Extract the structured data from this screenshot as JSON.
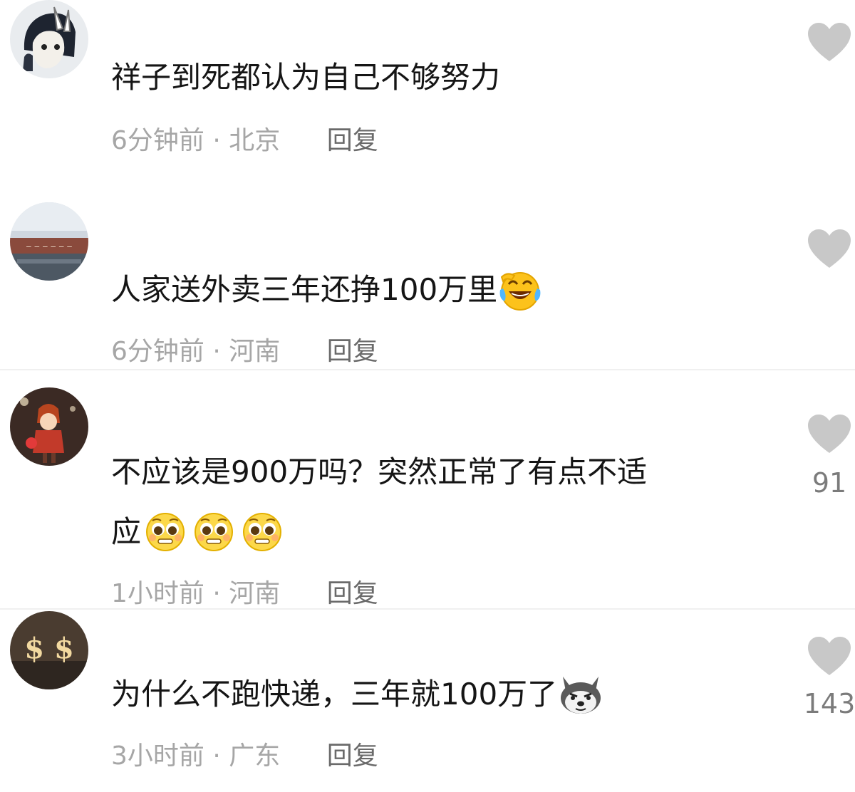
{
  "comments": [
    {
      "text": "祥子到死都认为自己不够努力",
      "time": "6分钟前",
      "location": "北京",
      "reply_label": "回复",
      "likes": ""
    },
    {
      "text": "人家送外卖三年还挣100万里",
      "time": "6分钟前",
      "location": "河南",
      "reply_label": "回复",
      "likes": ""
    },
    {
      "text_line1": "不应该是900万吗？突然正常了有点不适",
      "text_line2": "应",
      "time": "1小时前",
      "location": "河南",
      "reply_label": "回复",
      "likes": "91"
    },
    {
      "text": "为什么不跑快递，三年就100万了",
      "time": "3小时前",
      "location": "广东",
      "reply_label": "回复",
      "likes": "143"
    }
  ],
  "meta_separator": "·",
  "icons": {
    "like": "heart-icon",
    "emoji_laugh": "laughing-tears-emoji",
    "emoji_pleading": "pleading-face-emoji",
    "emoji_dog": "doge-emoji"
  },
  "colors": {
    "text": "#151515",
    "meta": "#a6a6a6",
    "reply": "#6a6a6a",
    "heart": "#c8c8c8",
    "count": "#7b7b7b"
  }
}
